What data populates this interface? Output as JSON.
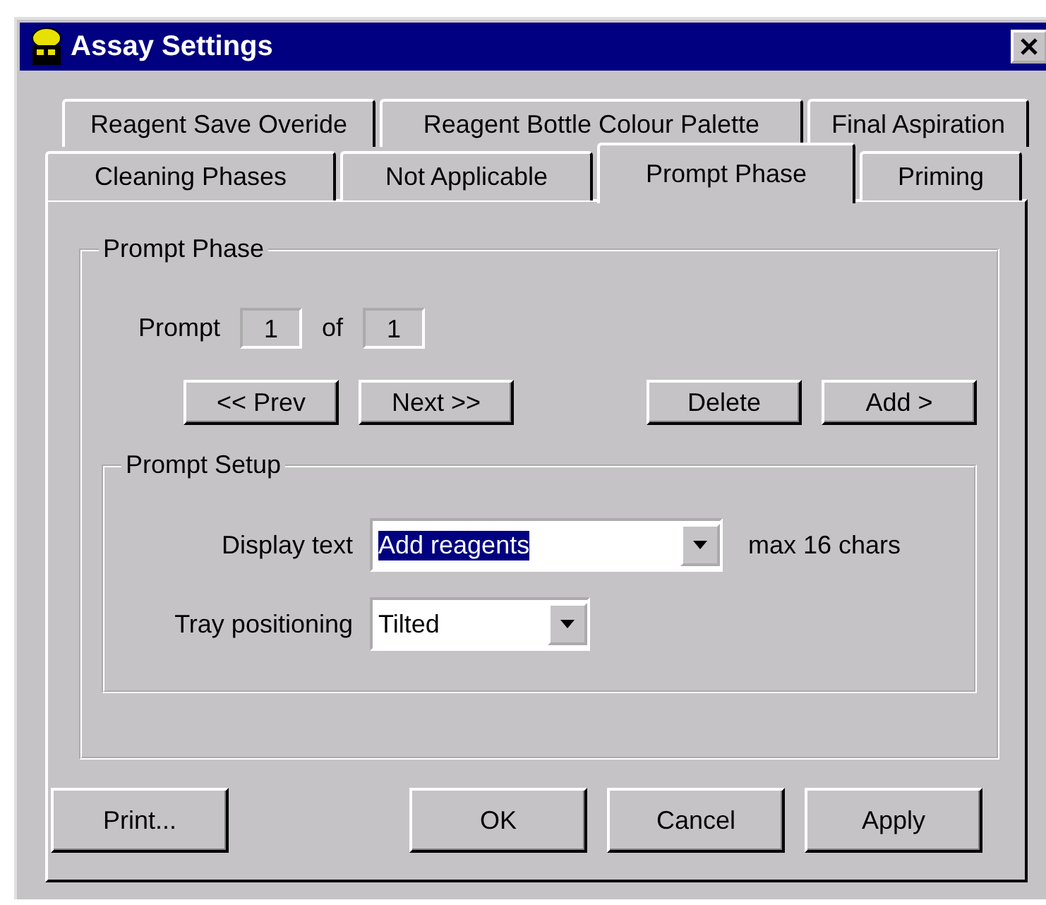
{
  "window": {
    "title": "Assay Settings"
  },
  "tab_rows": [
    [
      {
        "label": "Reagent Save Overide",
        "selected": false
      },
      {
        "label": "Reagent Bottle Colour Palette",
        "selected": false
      },
      {
        "label": "Final Aspiration",
        "selected": false
      }
    ],
    [
      {
        "label": "Cleaning Phases",
        "selected": false
      },
      {
        "label": "Not Applicable",
        "selected": false
      },
      {
        "label": "Prompt Phase",
        "selected": true
      },
      {
        "label": "Priming",
        "selected": false
      }
    ]
  ],
  "prompt_group": {
    "title": "Prompt Phase",
    "prompt_label": "Prompt",
    "current": "1",
    "of_label": "of",
    "total": "1",
    "nav_buttons": [
      "<< Prev",
      "Next >>"
    ],
    "edit_buttons": [
      "Delete",
      "Add >"
    ]
  },
  "setup_group": {
    "title": "Prompt Setup",
    "fields": [
      {
        "label": "Display text",
        "value": "Add reagents",
        "text_selected": true,
        "hint": "max 16 chars"
      },
      {
        "label": "Tray positioning",
        "value": "Tilted",
        "text_selected": false
      }
    ]
  },
  "footer_buttons": [
    "Print...",
    "OK",
    "Cancel",
    "Apply"
  ]
}
